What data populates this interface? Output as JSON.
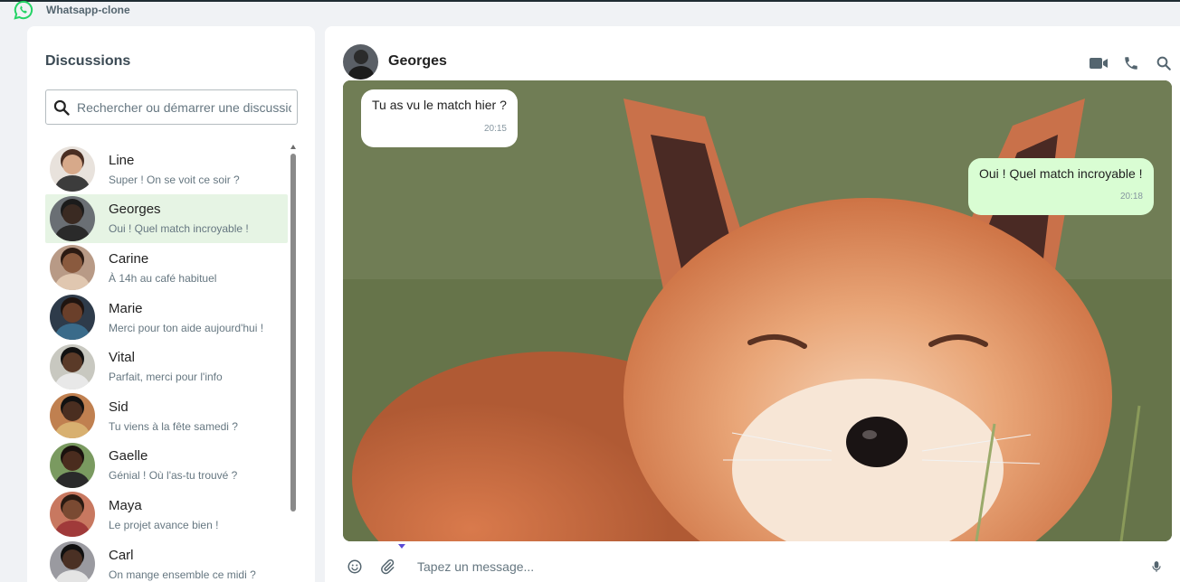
{
  "app": {
    "title": "Whatsapp-clone",
    "logo_icon": "whatsapp-logo-icon",
    "brand_color": "#25d366"
  },
  "sidebar": {
    "title": "Discussions",
    "search": {
      "placeholder": "Rechercher ou démarrer une discussion",
      "value": ""
    },
    "chats": [
      {
        "name": "Line",
        "preview": "Super ! On se voit ce soir ?",
        "skin": "#d7a98a",
        "hair": "#4a2e22",
        "cloth": "#3c3c3c",
        "bg": "#e8e2dc"
      },
      {
        "name": "Georges",
        "preview": "Oui ! Quel match incroyable !",
        "skin": "#3a2a22",
        "hair": "#1b1b1b",
        "cloth": "#2a2a2a",
        "bg": "#6a6f74"
      },
      {
        "name": "Carine",
        "preview": "À 14h au café habituel",
        "skin": "#8a5a3e",
        "hair": "#2b1a12",
        "cloth": "#e0c7b0",
        "bg": "#b89a86"
      },
      {
        "name": "Marie",
        "preview": "Merci pour ton aide aujourd'hui !",
        "skin": "#6a3f2a",
        "hair": "#1f1410",
        "cloth": "#3a6b8a",
        "bg": "#2e3b4a"
      },
      {
        "name": "Vital",
        "preview": "Parfait, merci pour l'info",
        "skin": "#5a3a28",
        "hair": "#111111",
        "cloth": "#e8e8e8",
        "bg": "#c8c8c0"
      },
      {
        "name": "Sid",
        "preview": "Tu viens à la fête samedi ?",
        "skin": "#4a2e20",
        "hair": "#111111",
        "cloth": "#d8b070",
        "bg": "#c08050"
      },
      {
        "name": "Gaelle",
        "preview": "Génial ! Où l'as-tu trouvé ?",
        "skin": "#4a2c1e",
        "hair": "#1a120e",
        "cloth": "#2a2a2a",
        "bg": "#7a9a60"
      },
      {
        "name": "Maya",
        "preview": "Le projet avance bien !",
        "skin": "#7a4a32",
        "hair": "#2a1a12",
        "cloth": "#a03a3a",
        "bg": "#c87860"
      },
      {
        "name": "Carl",
        "preview": "On mange ensemble ce midi ?",
        "skin": "#4a3024",
        "hair": "#101010",
        "cloth": "#e4e4e4",
        "bg": "#9a9aa0"
      }
    ],
    "active_chat": "Georges",
    "active_color": "#e6f4e4"
  },
  "conversation": {
    "contact_name": "Georges",
    "header_icons": [
      "video-call-icon",
      "phone-icon",
      "search-icon"
    ],
    "messages": [
      {
        "direction": "in",
        "text": "Tu as vu le match hier ?",
        "time": "20:15"
      },
      {
        "direction": "out",
        "text": "Oui ! Quel match incroyable !",
        "time": "20:18"
      }
    ],
    "bubble_colors": {
      "in": "#ffffff",
      "out": "#d9fdd3"
    }
  },
  "composer": {
    "placeholder": "Tapez un message...",
    "value": "",
    "icons": [
      "emoji-icon",
      "attach-icon",
      "microphone-icon"
    ]
  }
}
